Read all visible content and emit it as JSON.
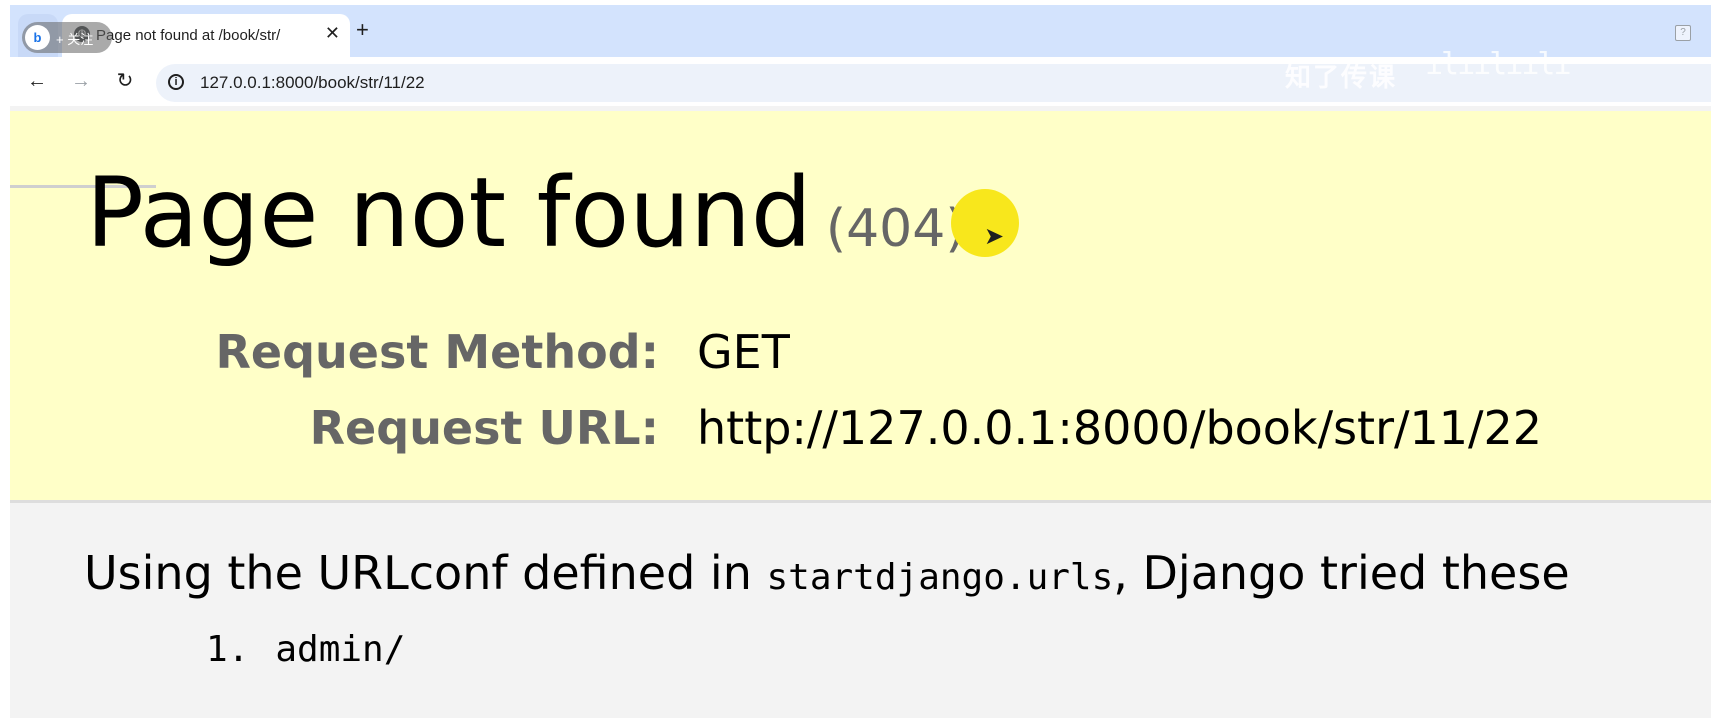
{
  "browser": {
    "tab": {
      "title": "Page not found at /book/str/",
      "close_icon": "✕",
      "favicon": "globe-icon"
    },
    "new_tab_icon": "+",
    "follow": {
      "label": "+ 关注",
      "logo": "b"
    },
    "toolbar": {
      "back_icon": "←",
      "forward_icon": "→",
      "reload_icon": "↻",
      "info_icon": "i",
      "url": "127.0.0.1:8000/book/str/11/22"
    },
    "watermark": {
      "text": "知了传课",
      "bars": "ılıılıılı"
    },
    "help_icon": "?"
  },
  "page": {
    "heading": "Page not found",
    "status_code": "(404)",
    "request_method_label": "Request Method:",
    "request_method_value": "GET",
    "request_url_label": "Request URL:",
    "request_url_value": "http://127.0.0.1:8000/book/str/11/22",
    "info_prefix": "Using the URLconf defined in",
    "urlconf": "startdjango.urls",
    "info_suffix": ", Django tried these",
    "patterns": [
      {
        "number": "1.",
        "pattern": "admin/"
      }
    ]
  },
  "colors": {
    "tabstrip": "#d3e3fd",
    "summary_bg": "#ffffc8",
    "cursor_highlight": "#f8e71c",
    "label_gray": "#666666"
  }
}
